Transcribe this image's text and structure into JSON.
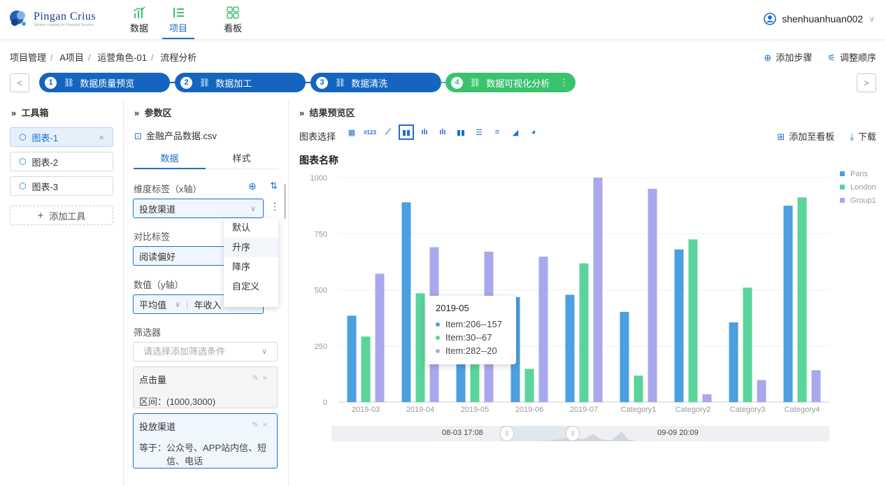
{
  "app": {
    "logo_name": "Pingan Crius",
    "logo_sub": "Solution Landing for Financial Services",
    "nav": [
      {
        "label": "数据"
      },
      {
        "label": "项目"
      },
      {
        "label": "看板"
      }
    ],
    "user": "shenhuanhuan002"
  },
  "breadcrumb": [
    "项目管理",
    "A项目",
    "运营角色-01",
    "流程分析"
  ],
  "crumb_actions": {
    "add_step": "添加步骤",
    "reorder": "调整顺序"
  },
  "steps": [
    {
      "num": "1",
      "label": "数据质量预览"
    },
    {
      "num": "2",
      "label": "数据加工"
    },
    {
      "num": "3",
      "label": "数据清洗"
    },
    {
      "num": "4",
      "label": "数据可视化分析"
    }
  ],
  "toolbox": {
    "title": "工具箱",
    "items": [
      "图表-1",
      "图表-2",
      "图表-3"
    ],
    "add": "添加工具"
  },
  "params": {
    "title": "参数区",
    "file": "金融产品数据.csv",
    "tabs": [
      "数据",
      "样式"
    ],
    "dim_label": "维度标签（x轴）",
    "dim_value": "投放渠道",
    "compare_label": "对比标签",
    "compare_value": "阅读偏好",
    "value_label": "数值（y轴）",
    "value_agg": "平均值",
    "value_field": "年收入",
    "filter_label": "筛选器",
    "filter_placeholder": "请选择添加筛选条件",
    "filters": [
      {
        "name": "点击量",
        "desc": "区间：(1000,3000)"
      },
      {
        "name": "投放渠道",
        "desc_prefix": "等于：",
        "desc": "公众号、APP站内信、短信、电话"
      }
    ],
    "sort_menu": [
      "默认",
      "升序",
      "降序",
      "自定义"
    ]
  },
  "preview": {
    "title": "结果预览区",
    "chart_select": "图表选择",
    "add_board": "添加至看板",
    "download": "下载",
    "chart_title": "图表名称",
    "range_start": "08-03 17:08",
    "range_end": "09-09 20:09"
  },
  "tooltip": {
    "title": "2019-05",
    "rows": [
      "Item:206--157",
      "Item:30--67",
      "Item:282--20"
    ]
  },
  "colors": {
    "brand": "#1d6fce",
    "step_active": "#3bc26f",
    "paris": "#4c9fe0",
    "london": "#5ad49b",
    "group1": "#a9a8ec"
  },
  "chart_data": {
    "type": "bar",
    "title": "图表名称",
    "categories": [
      "2019-03",
      "2019-04",
      "2019-05",
      "2019-06",
      "2019-07",
      "Category1",
      "Category2",
      "Category3",
      "Category4"
    ],
    "series": [
      {
        "name": "Paris",
        "values": [
          385,
          890,
          400,
          468,
          478,
          402,
          680,
          355,
          875
        ]
      },
      {
        "name": "London",
        "values": [
          292,
          485,
          220,
          148,
          618,
          118,
          725,
          510,
          912
        ]
      },
      {
        "name": "Group1",
        "values": [
          572,
          690,
          670,
          648,
          1000,
          950,
          35,
          98,
          142
        ]
      }
    ],
    "yticks": [
      "0",
      "250",
      "500",
      "750",
      "1000"
    ],
    "ylim": [
      0,
      1000
    ],
    "legend": "top-right",
    "grid": true
  }
}
